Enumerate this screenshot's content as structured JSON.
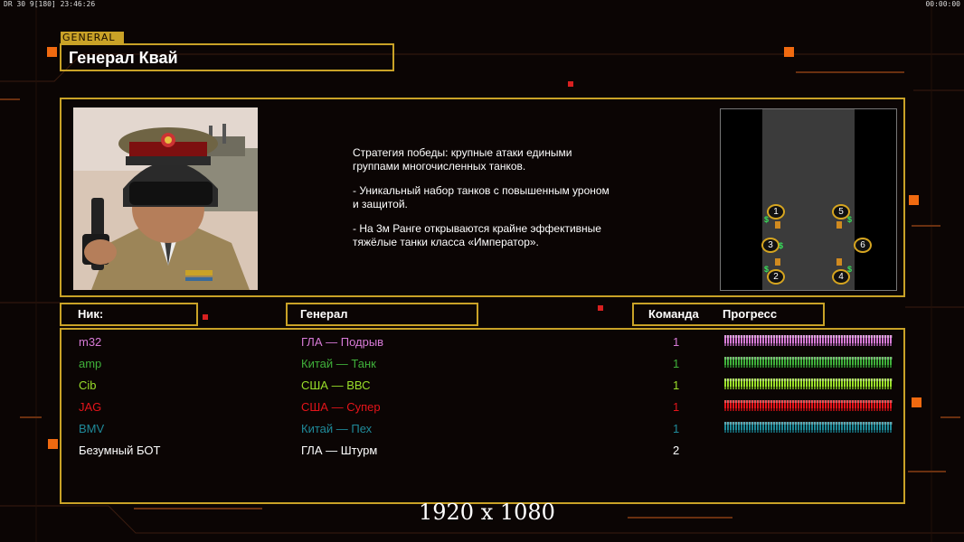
{
  "hud": {
    "left": "DR 30 9[180] 23:46:26",
    "right": "00:00:00"
  },
  "header": {
    "tag": "GENERAL",
    "title": "Генерал Квай"
  },
  "description": [
    "Стратегия победы: крупные атаки едиными\n группами многочисленных танков.",
    "- Уникальный набор танков с повышенным уроном\n и защитой.",
    "- На 3м Ранге открываются крайне эффективные\n тяжёлые танки класса «Император»."
  ],
  "map": {
    "slots": [
      "1",
      "2",
      "3",
      "4",
      "5",
      "6"
    ],
    "cash_symbol": "$"
  },
  "columns": {
    "nick": "Ник:",
    "general": "Генерал",
    "team": "Команда",
    "progress": "Прогресс"
  },
  "players": [
    {
      "nick": "m32",
      "general": "ГЛА — Подрыв",
      "team": "1",
      "color": "#d77ad6",
      "progress": 1.0
    },
    {
      "nick": "amp",
      "general": "Китай — Танк",
      "team": "1",
      "color": "#3fb03a",
      "progress": 1.0
    },
    {
      "nick": "Cib",
      "general": "США — ВВС",
      "team": "1",
      "color": "#9adf2a",
      "progress": 1.0
    },
    {
      "nick": "JAG",
      "general": "США — Супер",
      "team": "1",
      "color": "#e4141a",
      "progress": 1.0
    },
    {
      "nick": "BMV",
      "general": "Китай — Пех",
      "team": "1",
      "color": "#1f8a9a",
      "progress": 1.0
    },
    {
      "nick": "Безумный БОТ",
      "general": "ГЛА — Штурм",
      "team": "2",
      "color": "#ffffff",
      "progress": null
    }
  ],
  "resolution_label": "1920 x 1080",
  "colors": {
    "frame": "#c9a227",
    "accent": "#f06a10"
  }
}
